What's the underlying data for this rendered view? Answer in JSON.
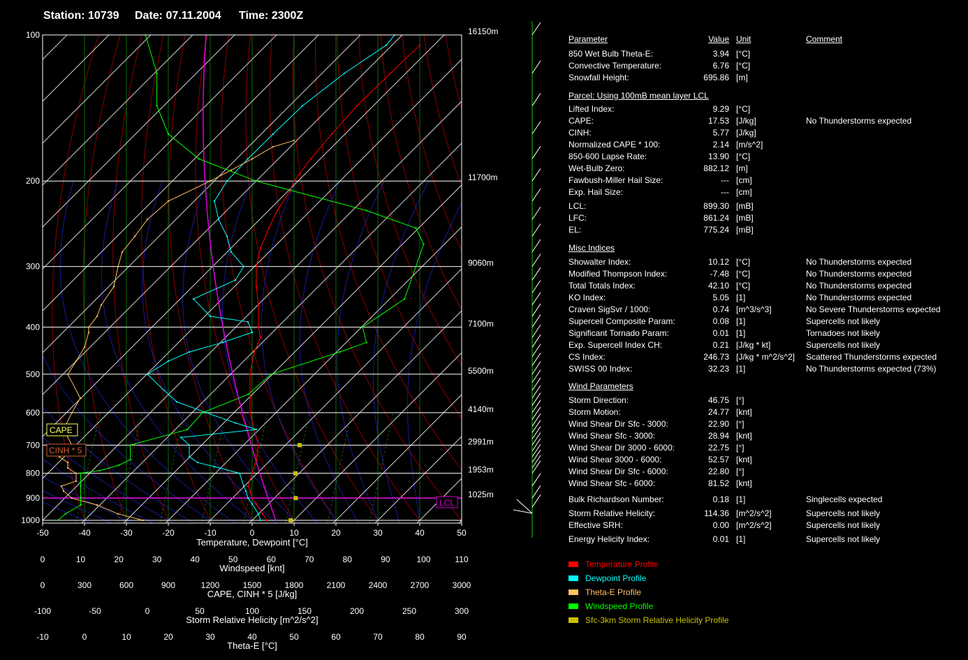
{
  "header": {
    "station": "Station: 10739",
    "date": "Date: 07.11.2004",
    "time": "Time: 2300Z"
  },
  "colors": {
    "temperature": "#ff0000",
    "dewpoint": "#00ffff",
    "theta_e": "#ffc060",
    "windspeed": "#00ff00",
    "srh": "#c8c000",
    "lcl": "#cc00cc",
    "cape_box": "#ffff60",
    "cinh_box": "#d06030"
  },
  "chart_data": {
    "type": "line",
    "title": "",
    "xlabel": "Temperature, Dewpoint [°C]",
    "ylabel": "",
    "x_range": [
      -50,
      50
    ],
    "y_log_scale": true,
    "pressure_ticks": [
      "100",
      "200",
      "300",
      "400",
      "500",
      "600",
      "700",
      "800",
      "900",
      "1000"
    ],
    "pressure_values": [
      100,
      200,
      300,
      400,
      500,
      600,
      700,
      800,
      900,
      1000
    ],
    "temp_ticks": [
      "-50",
      "-40",
      "-30",
      "-20",
      "-10",
      "0",
      "10",
      "20",
      "30",
      "40",
      "50"
    ],
    "height_labels": [
      {
        "p": 100,
        "label": "16150m"
      },
      {
        "p": 200,
        "label": "11700m"
      },
      {
        "p": 300,
        "label": "9060m"
      },
      {
        "p": 400,
        "label": "7100m"
      },
      {
        "p": 500,
        "label": "5500m"
      },
      {
        "p": 600,
        "label": "4140m"
      },
      {
        "p": 700,
        "label": "2991m"
      },
      {
        "p": 800,
        "label": "1953m"
      },
      {
        "p": 900,
        "label": "1025m"
      }
    ],
    "lcl_pressure": 899.3,
    "lcl_label": "LCL",
    "cape_label": "CAPE",
    "cinh_label": "CINH * 5",
    "secondary_axes": [
      {
        "name": "Windspeed  [knt]",
        "ticks": [
          "0",
          "10",
          "20",
          "30",
          "40",
          "50",
          "60",
          "70",
          "80",
          "90",
          "100",
          "110"
        ]
      },
      {
        "name": "CAPE, CINH * 5  [J/kg]",
        "ticks": [
          "0",
          "300",
          "600",
          "900",
          "1200",
          "1500",
          "1800",
          "2100",
          "2400",
          "2700",
          "3000"
        ]
      },
      {
        "name": "Storm Relative Helicity  [m^2/s^2]",
        "ticks": [
          "-100",
          "-50",
          "0",
          "50",
          "100",
          "150",
          "200",
          "250",
          "300"
        ]
      },
      {
        "name": "Theta-E  [°C]",
        "ticks": [
          "-10",
          "0",
          "10",
          "20",
          "30",
          "40",
          "50",
          "60",
          "70",
          "80",
          "90"
        ]
      }
    ],
    "series": [
      {
        "name": "Temperature Profile",
        "points": [
          [
            1000,
            3.5
          ],
          [
            970,
            2.5
          ],
          [
            925,
            1
          ],
          [
            900,
            0
          ],
          [
            870,
            -0.5
          ],
          [
            850,
            -1
          ],
          [
            800,
            0
          ],
          [
            750,
            1
          ],
          [
            700,
            1.5
          ],
          [
            650,
            0.5
          ],
          [
            600,
            -0.5
          ],
          [
            560,
            -0.5
          ],
          [
            500,
            -0.5
          ],
          [
            450,
            0.5
          ],
          [
            420,
            2
          ],
          [
            400,
            1.5
          ],
          [
            360,
            1.5
          ],
          [
            330,
            1
          ],
          [
            300,
            1
          ],
          [
            275,
            2
          ],
          [
            250,
            4
          ],
          [
            230,
            6
          ],
          [
            210,
            9
          ],
          [
            200,
            10
          ],
          [
            180,
            14
          ],
          [
            160,
            19
          ],
          [
            140,
            25
          ],
          [
            120,
            33
          ],
          [
            105,
            40
          ]
        ]
      },
      {
        "name": "Dewpoint Profile",
        "points": [
          [
            1000,
            2
          ],
          [
            970,
            1.5
          ],
          [
            925,
            0
          ],
          [
            900,
            -1
          ],
          [
            870,
            -1.5
          ],
          [
            850,
            -2
          ],
          [
            800,
            -3
          ],
          [
            775,
            -9
          ],
          [
            760,
            -13
          ],
          [
            740,
            -15
          ],
          [
            700,
            -15
          ],
          [
            675,
            -17
          ],
          [
            650,
            1
          ],
          [
            630,
            -4
          ],
          [
            600,
            -11
          ],
          [
            570,
            -18
          ],
          [
            540,
            -21
          ],
          [
            500,
            -25
          ],
          [
            470,
            -20
          ],
          [
            450,
            -15
          ],
          [
            430,
            -7
          ],
          [
            410,
            0
          ],
          [
            390,
            -1
          ],
          [
            380,
            -10
          ],
          [
            350,
            -14
          ],
          [
            320,
            -4
          ],
          [
            300,
            -2
          ],
          [
            280,
            -5
          ],
          [
            260,
            -6
          ],
          [
            240,
            -8
          ],
          [
            220,
            -9
          ],
          [
            200,
            -6
          ],
          [
            180,
            -1
          ],
          [
            160,
            5
          ],
          [
            140,
            12
          ],
          [
            120,
            22
          ],
          [
            105,
            32
          ],
          [
            100,
            34
          ]
        ]
      },
      {
        "name": "Theta-E Profile",
        "points": [
          [
            1000,
            14
          ],
          [
            970,
            8
          ],
          [
            930,
            3
          ],
          [
            900,
            -3
          ],
          [
            870,
            -5
          ],
          [
            850,
            -5.5
          ],
          [
            830,
            -2
          ],
          [
            800,
            -2
          ],
          [
            780,
            -4
          ],
          [
            760,
            -4
          ],
          [
            740,
            -6
          ],
          [
            700,
            -3
          ],
          [
            650,
            -5
          ],
          [
            600,
            -3
          ],
          [
            560,
            -1
          ],
          [
            500,
            -4
          ],
          [
            470,
            -2
          ],
          [
            440,
            0
          ],
          [
            410,
            1
          ],
          [
            400,
            1
          ],
          [
            380,
            3
          ],
          [
            360,
            4
          ],
          [
            330,
            7
          ],
          [
            300,
            8
          ],
          [
            280,
            9
          ],
          [
            260,
            12
          ],
          [
            240,
            15
          ],
          [
            220,
            20
          ],
          [
            200,
            30
          ],
          [
            190,
            35
          ],
          [
            180,
            40
          ],
          [
            170,
            45
          ],
          [
            165,
            50
          ]
        ]
      },
      {
        "name": "Windspeed Profile",
        "points": [
          [
            1000,
            4
          ],
          [
            970,
            6
          ],
          [
            930,
            10
          ],
          [
            900,
            10
          ],
          [
            850,
            10
          ],
          [
            800,
            10
          ],
          [
            790,
            15
          ],
          [
            770,
            20
          ],
          [
            750,
            23
          ],
          [
            700,
            23
          ],
          [
            650,
            38
          ],
          [
            600,
            42
          ],
          [
            550,
            54
          ],
          [
            500,
            60
          ],
          [
            450,
            78
          ],
          [
            430,
            85
          ],
          [
            400,
            84
          ],
          [
            350,
            95
          ],
          [
            300,
            98
          ],
          [
            270,
            100
          ],
          [
            250,
            98
          ],
          [
            230,
            85
          ],
          [
            200,
            56
          ],
          [
            180,
            41
          ],
          [
            160,
            33
          ],
          [
            140,
            30
          ],
          [
            120,
            30
          ],
          [
            100,
            27
          ]
        ]
      },
      {
        "name": "Sfc-3km Storm Relative Helicity Profile",
        "points": [
          [
            1000,
            3.5
          ],
          [
            900,
            8.3
          ],
          [
            800,
            8
          ],
          [
            700,
            12
          ]
        ]
      }
    ]
  },
  "params": {
    "headers": {
      "parameter": "Parameter",
      "value": "Value",
      "unit": "Unit",
      "comment": "Comment"
    },
    "group1": [
      {
        "name": "850 Wet Bulb Theta-E:",
        "value": "3.94",
        "unit": "[°C]",
        "comment": ""
      },
      {
        "name": "Convective Temperature:",
        "value": "6.76",
        "unit": "[°C]",
        "comment": ""
      },
      {
        "name": "Snowfall Height:",
        "value": "695.86",
        "unit": "[m]",
        "comment": ""
      }
    ],
    "parcel_title": "Parcel: Using 100mB mean layer LCL",
    "parcel": [
      {
        "name": "Lifted Index:",
        "value": "9.29",
        "unit": "[°C]",
        "comment": ""
      },
      {
        "name": "CAPE:",
        "value": "17.53",
        "unit": "[J/kg]",
        "comment": "No Thunderstorms expected"
      },
      {
        "name": "CINH:",
        "value": "5.77",
        "unit": "[J/kg]",
        "comment": ""
      },
      {
        "name": "Normalized CAPE * 100:",
        "value": "2.14",
        "unit": "[m/s^2]",
        "comment": ""
      },
      {
        "name": "850-600 Lapse Rate:",
        "value": "13.90",
        "unit": "[°C]",
        "comment": ""
      },
      {
        "name": "Wet-Bulb Zero:",
        "value": "882.12",
        "unit": "[m]",
        "comment": ""
      },
      {
        "name": "Fawbush-Miller Hail Size:",
        "value": "---",
        "unit": "[cm]",
        "comment": ""
      },
      {
        "name": "Exp. Hail Size:",
        "value": "---",
        "unit": "[cm]",
        "comment": ""
      }
    ],
    "levels": [
      {
        "name": "LCL:",
        "value": "899.30",
        "unit": "[mB]",
        "comment": ""
      },
      {
        "name": "LFC:",
        "value": "861.24",
        "unit": "[mB]",
        "comment": ""
      },
      {
        "name": "EL:",
        "value": "775.24",
        "unit": "[mB]",
        "comment": ""
      }
    ],
    "misc_title": "Misc Indices",
    "misc": [
      {
        "name": "Showalter Index:",
        "value": "10.12",
        "unit": "[°C]",
        "comment": "No Thunderstorms expected"
      },
      {
        "name": "Modified Thompson Index:",
        "value": "-7.48",
        "unit": "[°C]",
        "comment": "No Thunderstorms expected"
      },
      {
        "name": "Total Totals Index:",
        "value": "42.10",
        "unit": "[°C]",
        "comment": "No Thunderstorms expected"
      },
      {
        "name": "KO Index:",
        "value": "5.05",
        "unit": "[1]",
        "comment": "No Thunderstorms expected"
      },
      {
        "name": "Craven SigSvr / 1000:",
        "value": "0.74",
        "unit": "[m^3/s^3]",
        "comment": "No Severe Thunderstorms expected"
      },
      {
        "name": "Supercell Composite Param:",
        "value": "0.08",
        "unit": "[1]",
        "comment": "Supercells not likely"
      },
      {
        "name": "Significant Tornado Param:",
        "value": "0.01",
        "unit": "[1]",
        "comment": "Tornadoes not likely"
      },
      {
        "name": "Exp. Supercell Index CH:",
        "value": "0.21",
        "unit": "[J/kg * kt]",
        "comment": "Supercells not likely"
      },
      {
        "name": "CS Index:",
        "value": "246.73",
        "unit": "[J/kg * m^2/s^2]",
        "comment": "Scattered Thunderstorms expected"
      },
      {
        "name": "SWISS 00 Index:",
        "value": "32.23",
        "unit": "[1]",
        "comment": "No Thunderstorms expected (73%)"
      }
    ],
    "wind_title": "Wind Parameters",
    "wind": [
      {
        "name": "Storm Direction:",
        "value": "46.75",
        "unit": "[°]",
        "comment": ""
      },
      {
        "name": "Storm Motion:",
        "value": "24.77",
        "unit": "[knt]",
        "comment": ""
      },
      {
        "name": "Wind Shear Dir Sfc - 3000:",
        "value": "22.90",
        "unit": "[°]",
        "comment": ""
      },
      {
        "name": "Wind Shear Sfc - 3000:",
        "value": "28.94",
        "unit": "[knt]",
        "comment": ""
      },
      {
        "name": "Wind Shear Dir 3000 - 6000:",
        "value": "22.75",
        "unit": "[°]",
        "comment": ""
      },
      {
        "name": "Wind Shear 3000 - 6000:",
        "value": "52.57",
        "unit": "[knt]",
        "comment": ""
      },
      {
        "name": "Wind Shear Dir Sfc - 6000:",
        "value": "22.80",
        "unit": "[°]",
        "comment": ""
      },
      {
        "name": "Wind Shear Sfc - 6000:",
        "value": "81.52",
        "unit": "[knt]",
        "comment": ""
      }
    ],
    "wind2": [
      {
        "name": "Bulk Richardson Number:",
        "value": "0.18",
        "unit": "[1]",
        "comment": "Singlecells expected"
      },
      {
        "name": "Storm Relative Helicity:",
        "value": "114.36",
        "unit": "[m^2/s^2]",
        "comment": "Supercells not likely"
      },
      {
        "name": "Effective SRH:",
        "value": "0.00",
        "unit": "[m^2/s^2]",
        "comment": "Supercells not likely"
      },
      {
        "name": "Energy Helicity Index:",
        "value": "0.01",
        "unit": "[1]",
        "comment": "Supercells not likely"
      }
    ]
  },
  "legend": [
    {
      "label": "Temperature Profile",
      "color": "#ff0000"
    },
    {
      "label": "Dewpoint Profile",
      "color": "#00ffff"
    },
    {
      "label": "Theta-E Profile",
      "color": "#ffc060"
    },
    {
      "label": "Windspeed Profile",
      "color": "#00ff00"
    },
    {
      "label": "Sfc-3km Storm Relative Helicity Profile",
      "color": "#c8c000"
    }
  ]
}
